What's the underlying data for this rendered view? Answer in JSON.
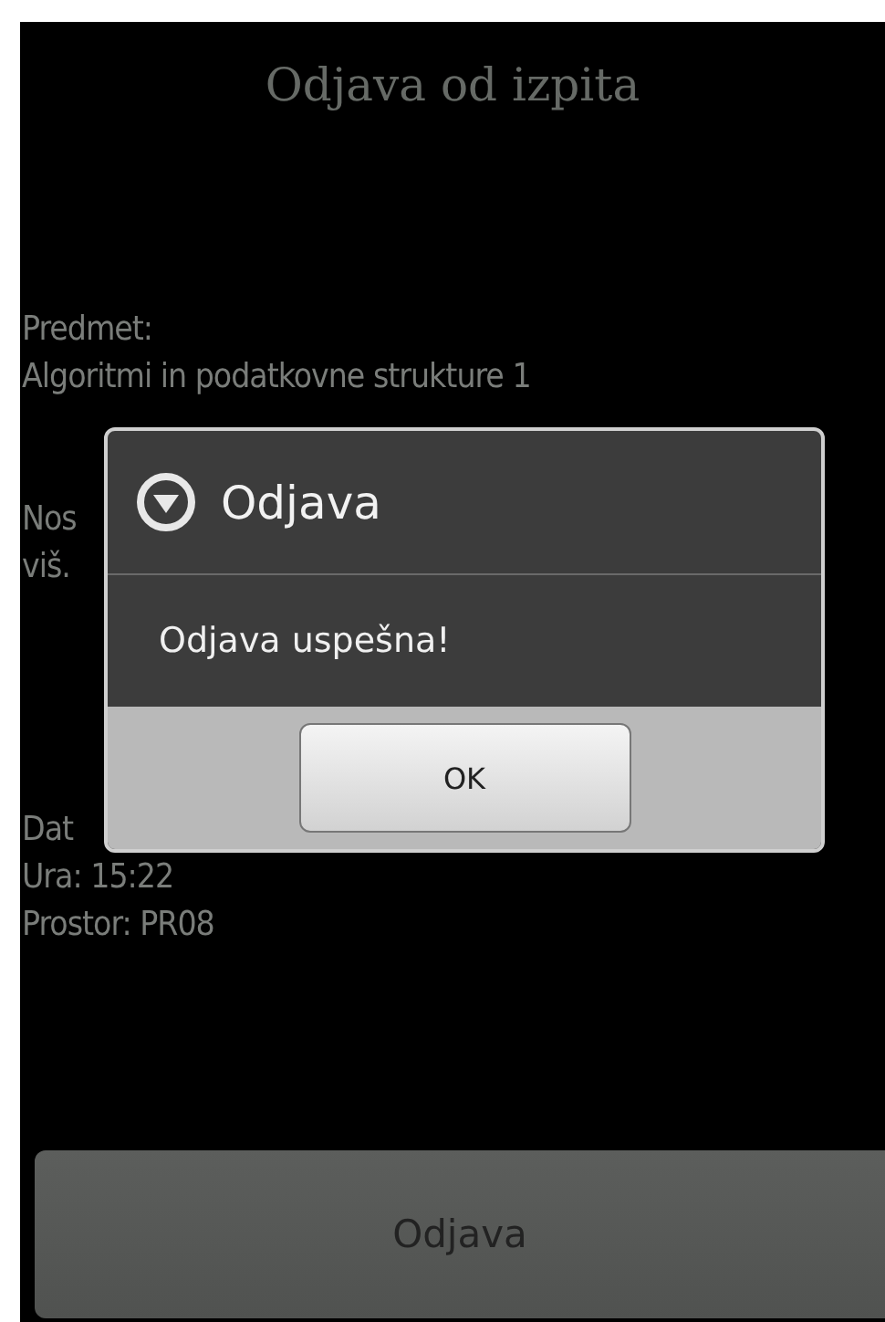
{
  "screen": {
    "title": "Odjava od izpita"
  },
  "info_groups": [
    [
      "Predmet:",
      "Algoritmi in podatkovne strukture 1"
    ],
    [
      "Nos",
      "viš."
    ],
    [
      "Dat",
      "Ura: 15:22",
      "Prostor: PR08"
    ]
  ],
  "action_button": "Odjava",
  "dialog": {
    "title": "Odjava",
    "message": "Odjava uspešna!",
    "buttons": [
      "OK"
    ]
  }
}
